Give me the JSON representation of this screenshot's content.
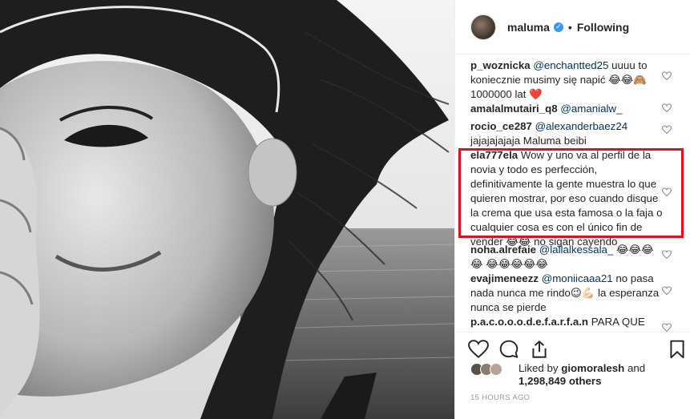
{
  "post": {
    "username": "maluma",
    "verified_icon": "verified-badge-icon",
    "separator": "•",
    "follow_status": "Following"
  },
  "comments": [
    {
      "user": "p_woznicka",
      "mention": "@enchantted25",
      "text": " uuuu to koniecznie musimy się napić 😂😂🙈 1000000 lat ❤️"
    },
    {
      "user": "amalalmutairi_q8",
      "mention": "@amanialw_",
      "text": ""
    },
    {
      "user": "rocio_ce287",
      "mention": "@alexanderbaez24",
      "text": " jajajajajaja Maluma beibi"
    },
    {
      "user": "ela777ela",
      "mention": "",
      "text": " Wow y uno va al perfil de la novia y todo es perfección, definitivamente la gente muestra lo que quieren mostrar, por eso cuando disque la crema que usa esta famosa o la faja o cualquier cosa es con el único fin de vender 😂😂  no sigan cayendo"
    },
    {
      "user": "noha.alrefaie",
      "mention": "@lallalkessala_",
      "text": " 😂😂😂😂 😂😂😂😂😂"
    },
    {
      "user": "evajimeneezz",
      "mention": "@moniicaaa21",
      "text": " no pasa nada nunca me rindo😉💪🏻 la esperanza nunca se pierde"
    },
    {
      "user": "p.a.c.o.o.o.d.e.f.a.r.f.a.n",
      "mention": "",
      "text": " PARA QUE"
    }
  ],
  "likes": {
    "prefix": "Liked by ",
    "liker": "giomoralesh",
    "and": " and",
    "count_text": "1,298,849 others"
  },
  "timestamp": "15 HOURS AGO",
  "icons": {
    "like": "heart-icon",
    "comment": "comment-icon",
    "share": "share-icon",
    "save": "bookmark-icon"
  },
  "colors": {
    "highlight": "#e0101a",
    "mention": "#003569",
    "verified": "#3897f0",
    "muted": "#999999"
  }
}
